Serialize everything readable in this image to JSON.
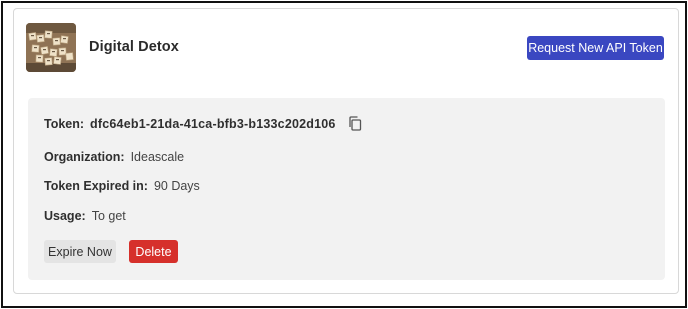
{
  "app": {
    "title": "Digital Detox",
    "thumbnail_icon": "scrabble-tiles-image",
    "request_button_label": "Request New API Token"
  },
  "token": {
    "token_label": "Token:",
    "token_value": "dfc64eb1-21da-41ca-bfb3-b133c202d106",
    "copy_icon": "copy-icon",
    "organization_label": "Organization:",
    "organization_value": "Ideascale",
    "expiry_label": "Token Expired in:",
    "expiry_value": "90 Days",
    "usage_label": "Usage:",
    "usage_value": "To get",
    "expire_button_label": "Expire Now",
    "delete_button_label": "Delete"
  },
  "colors": {
    "primary": "#3a47c1",
    "danger": "#d6302b",
    "panel_bg": "#f2f2f2",
    "secondary_btn": "#e4e4e4"
  }
}
